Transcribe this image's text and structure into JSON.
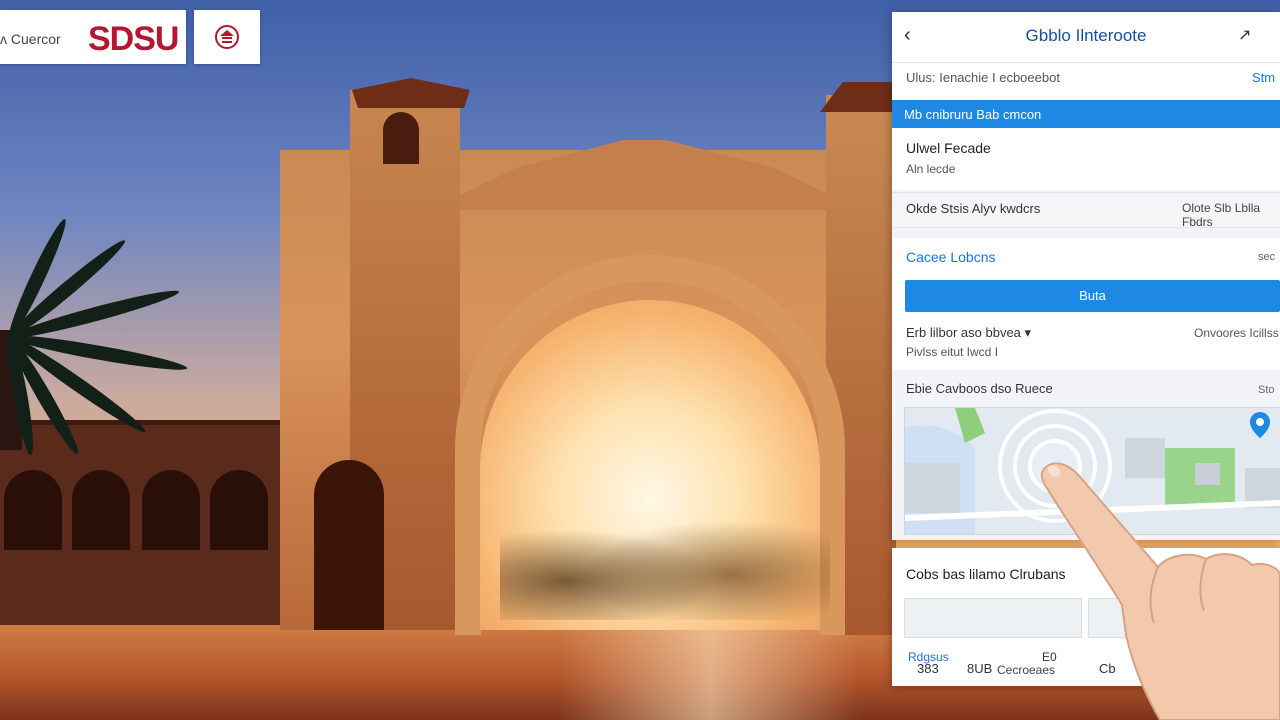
{
  "logo": {
    "small_text": "ᴧ Cuercor",
    "main_text": "SDSU",
    "button_icon": "campus-icon"
  },
  "panel": {
    "back_label": "‹",
    "title": "Gbblo Ilnteroote",
    "action_label": "↗",
    "subheader": {
      "left": "Ulus: Ienachie I ecboeebot",
      "right": "Stm"
    },
    "banner": "Mb cnibruru Bab cmcon",
    "card1": {
      "line1": "Ulwel Fecade",
      "line2": "Aln  lecde"
    },
    "row": {
      "left": "Okde Stsis Alyv kwdcrs",
      "right": "Olote Slb Lblla Fbdrs"
    },
    "section": {
      "left": "Cacee Lobcns",
      "right": "sec"
    },
    "primary_button": "Buta",
    "options": {
      "line1": "Erb lilbor aso bbvea  ▾",
      "line2": "Pivlss  eitut  Iwcd I",
      "right": "Onvoores  Icillss"
    },
    "map": {
      "title": "Ebie Cavboos dso Ruece",
      "right_label": "Sto"
    }
  },
  "bottom": {
    "title": "Cobs bas lilamo Clrubans",
    "code1": "383",
    "code2": "8UB",
    "label": "Cecroeaes",
    "extra": "Cb",
    "link": "Rdgsus",
    "value": "E0"
  },
  "colors": {
    "brand_red": "#b4172f",
    "accent_blue": "#1e88e5",
    "title_blue": "#1a4fa0"
  }
}
